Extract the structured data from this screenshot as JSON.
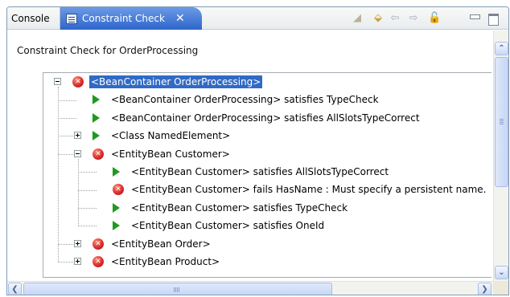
{
  "tabs": {
    "console": "Console",
    "constraint_check": "Constraint Check",
    "close_glyph": "✕"
  },
  "toolbar": {
    "icons": [
      "clear-icon",
      "filter-icon",
      "back-arrow-icon",
      "forward-arrow-icon",
      "lock-icon",
      "minimize-icon",
      "maximize-icon"
    ],
    "back_glyph": "⇦",
    "forward_glyph": "⇨",
    "clear_glyph": "◢",
    "filter_glyph": "⬙",
    "lock_glyph": "🔓"
  },
  "panel": {
    "heading": "Constraint Check for OrderProcessing"
  },
  "tree": {
    "nodes": [
      {
        "label": "<BeanContainer OrderProcessing>",
        "status": "error",
        "expander": "minus",
        "selected": true
      },
      {
        "label": "<BeanContainer OrderProcessing> satisfies TypeCheck",
        "status": "ok"
      },
      {
        "label": "<BeanContainer OrderProcessing> satisfies AllSlotsTypeCorrect",
        "status": "ok"
      },
      {
        "label": "<Class NamedElement>",
        "status": "ok",
        "expander": "plus"
      },
      {
        "label": "<EntityBean Customer>",
        "status": "error",
        "expander": "minus"
      },
      {
        "label": "<EntityBean Customer> satisfies AllSlotsTypeCorrect",
        "status": "ok"
      },
      {
        "label": "<EntityBean Customer> fails HasName : Must specify a persistent name.",
        "status": "error"
      },
      {
        "label": "<EntityBean Customer> satisfies TypeCheck",
        "status": "ok"
      },
      {
        "label": "<EntityBean Customer> satisfies OneId",
        "status": "ok"
      },
      {
        "label": "<EntityBean Order>",
        "status": "error",
        "expander": "plus"
      },
      {
        "label": "<EntityBean Product>",
        "status": "error",
        "expander": "plus"
      }
    ]
  },
  "scrollbars": {
    "up_glyph": "⌃",
    "down_glyph": "⌄",
    "left_glyph": "❮",
    "right_glyph": "❯"
  },
  "colors": {
    "selection": "#316ac5",
    "active_tab": "#2e66cc",
    "error": "#d8262a",
    "ok": "#1f9a1f"
  }
}
